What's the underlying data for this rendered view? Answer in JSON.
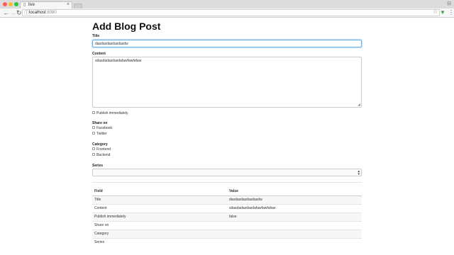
{
  "browser": {
    "tab_title": "live",
    "url_host": "localhost",
    "url_port": ":8080",
    "icons": [
      "back-icon",
      "forward-icon",
      "reload-icon",
      "info-icon",
      "star-icon",
      "extension-icon",
      "menu-icon"
    ],
    "glyphs": {
      "back": "←",
      "forward": "→",
      "reload": "↻",
      "info": "ⓘ",
      "star": "☆",
      "ext": "▼",
      "menu": "⋮",
      "close": "×",
      "doc": "▯",
      "user": "⊟"
    }
  },
  "page": {
    "heading": "Add Blog Post",
    "title_label": "Title",
    "title_value": "dasdasdasdasdasdw",
    "content_label": "Content",
    "content_value": "sdasdadasdasdafawfawfafaw",
    "publish_label": "Publish immediately",
    "share_label": "Share on",
    "share_options": [
      "Facebook",
      "Twitter"
    ],
    "category_label": "Category",
    "category_options": [
      "Frontend",
      "Backend"
    ],
    "series_label": "Series",
    "series_value": ""
  },
  "table": {
    "headers": [
      "Field",
      "Value"
    ],
    "rows": [
      [
        "Title",
        "dasdasdasdasdasdw"
      ],
      [
        "Content",
        "sdasdadasdasdafawfawfafaw"
      ],
      [
        "Publish immediately",
        "false"
      ],
      [
        "Share on",
        ""
      ],
      [
        "Category",
        ""
      ],
      [
        "Series",
        ""
      ]
    ]
  },
  "colors": {
    "focus": "#66afe9",
    "tab_bar": "#dcdcdc",
    "ext": "#2aa842"
  }
}
